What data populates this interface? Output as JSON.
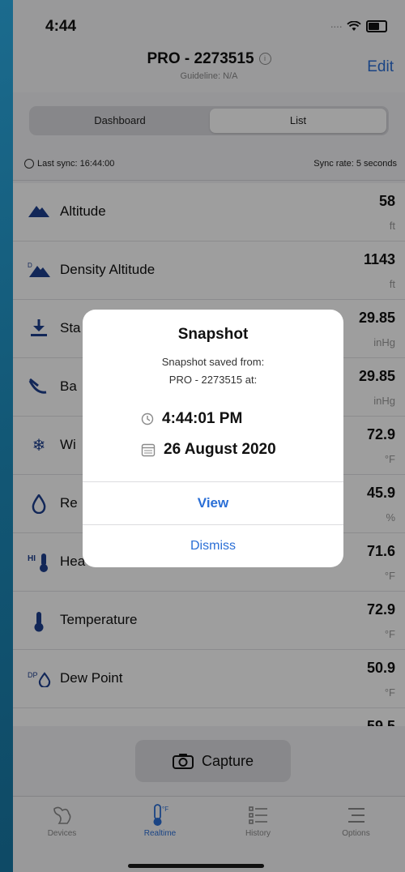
{
  "status": {
    "time": "4:44"
  },
  "nav": {
    "title": "PRO - 2273515",
    "subtitle": "Guideline: N/A",
    "edit_label": "Edit"
  },
  "segments": {
    "dashboard": "Dashboard",
    "list": "List",
    "selected": "List"
  },
  "sync": {
    "last_sync": "Last sync: 16:44:00",
    "sync_rate": "Sync rate: 5 seconds"
  },
  "rows": [
    {
      "label": "Altitude",
      "value": "58",
      "unit": "ft",
      "icon": "mountain-icon"
    },
    {
      "label": "Density Altitude",
      "value": "1143",
      "unit": "ft",
      "icon": "density-altitude-icon"
    },
    {
      "label": "Sta",
      "value": "29.85",
      "unit": "inHg",
      "icon": "station-pressure-icon"
    },
    {
      "label": "Ba",
      "value": "29.85",
      "unit": "inHg",
      "icon": "barometric-pressure-icon"
    },
    {
      "label": "Wi",
      "value": "72.9",
      "unit": "°F",
      "icon": "wind-chill-icon"
    },
    {
      "label": "Re",
      "value": "45.9",
      "unit": "%",
      "icon": "relative-humidity-icon"
    },
    {
      "label": "Hea",
      "value": "71.6",
      "unit": "°F",
      "icon": "heat-index-icon"
    },
    {
      "label": "Temperature",
      "value": "72.9",
      "unit": "°F",
      "icon": "thermometer-icon"
    },
    {
      "label": "Dew Point",
      "value": "50.9",
      "unit": "°F",
      "icon": "dew-point-icon"
    },
    {
      "label": "",
      "value": "59.5",
      "unit": "",
      "icon": ""
    }
  ],
  "capture": {
    "label": "Capture"
  },
  "tabs": [
    {
      "label": "Devices",
      "icon": "devices-icon",
      "active": false
    },
    {
      "label": "Realtime",
      "icon": "realtime-icon",
      "active": true
    },
    {
      "label": "History",
      "icon": "history-icon",
      "active": false
    },
    {
      "label": "Options",
      "icon": "options-icon",
      "active": false
    }
  ],
  "modal": {
    "title": "Snapshot",
    "message_line1": "Snapshot saved from:",
    "message_line2": "PRO - 2273515 at:",
    "time": "4:44:01 PM",
    "date": "26 August 2020",
    "view_label": "View",
    "dismiss_label": "Dismiss"
  },
  "colors": {
    "accent": "#2b6fd6",
    "icon_blue": "#1e3f8f",
    "background": "#125775"
  }
}
